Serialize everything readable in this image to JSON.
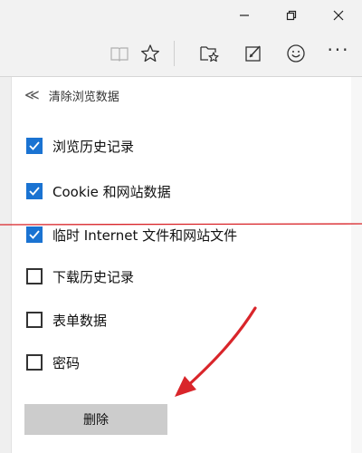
{
  "window": {
    "controls": [
      "minimize-icon",
      "restore-icon",
      "close-icon"
    ]
  },
  "toolbar": {
    "icons": [
      "reading-view-icon",
      "favorites-star-icon",
      "hub-icon",
      "web-note-icon",
      "feedback-smiley-icon",
      "more-icon"
    ],
    "more_label": "···"
  },
  "panel": {
    "back_icon": "double-chevron-left-icon",
    "back_label": "≪",
    "title": "清除浏览数据",
    "options": [
      {
        "label": "浏览历史记录",
        "checked": true
      },
      {
        "label": "Cookie 和网站数据",
        "checked": true
      },
      {
        "label": "临时 Internet 文件和网站文件",
        "checked": true
      },
      {
        "label": "下载历史记录",
        "checked": false
      },
      {
        "label": "表单数据",
        "checked": false
      },
      {
        "label": "密码",
        "checked": false
      }
    ],
    "delete_label": "删除"
  },
  "annotations": {
    "line_color": "#d9252a",
    "arrow_color": "#d9252a",
    "accent": "#1a73d2"
  }
}
